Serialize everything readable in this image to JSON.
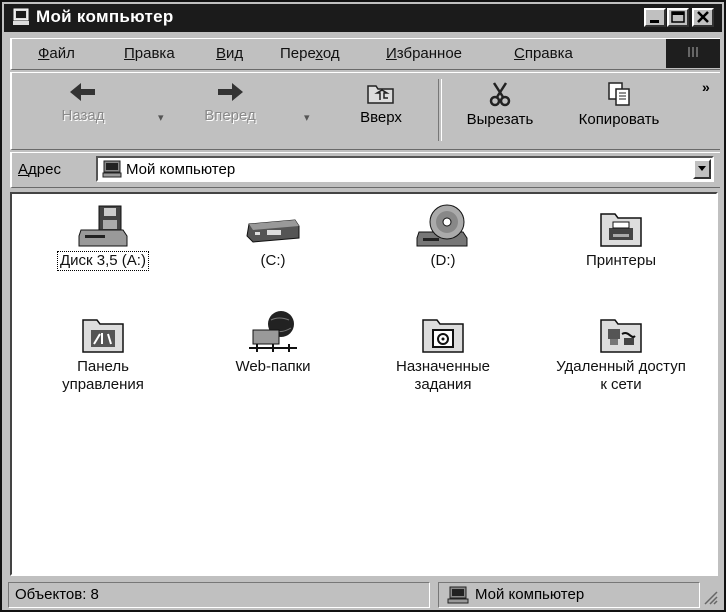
{
  "window": {
    "title": "Мой компьютер"
  },
  "menu": [
    {
      "u": "Ф",
      "rest": "айл"
    },
    {
      "u": "П",
      "rest": "равка"
    },
    {
      "u": "В",
      "rest": "ид"
    },
    {
      "pre": "Пере",
      "u": "х",
      "rest": "од"
    },
    {
      "u": "И",
      "rest": "збранное"
    },
    {
      "u": "С",
      "rest": "правка"
    }
  ],
  "toolbar": {
    "back": "Назад",
    "forward": "Вперед",
    "up": "Вверх",
    "cut": "Вырезать",
    "copy": "Копировать",
    "more": "»"
  },
  "address": {
    "label_u": "А",
    "label_rest": "дрес",
    "value": "Мой компьютер"
  },
  "items": [
    {
      "name": "Диск 3,5 (A:)",
      "icon": "floppy-drive-icon",
      "focused": true
    },
    {
      "name": "(C:)",
      "icon": "hard-drive-icon"
    },
    {
      "name": "(D:)",
      "icon": "cd-drive-icon"
    },
    {
      "name": "Принтеры",
      "icon": "printers-folder-icon"
    },
    {
      "name": "Панель\nуправления",
      "icon": "control-panel-folder-icon"
    },
    {
      "name": "Web-папки",
      "icon": "web-folders-icon"
    },
    {
      "name": "Назначенные\nзадания",
      "icon": "scheduled-tasks-folder-icon"
    },
    {
      "name": "Удаленный доступ\nк сети",
      "icon": "dial-up-networking-folder-icon"
    }
  ],
  "status": {
    "objects": "Объектов: 8",
    "location": "Мой компьютер"
  }
}
